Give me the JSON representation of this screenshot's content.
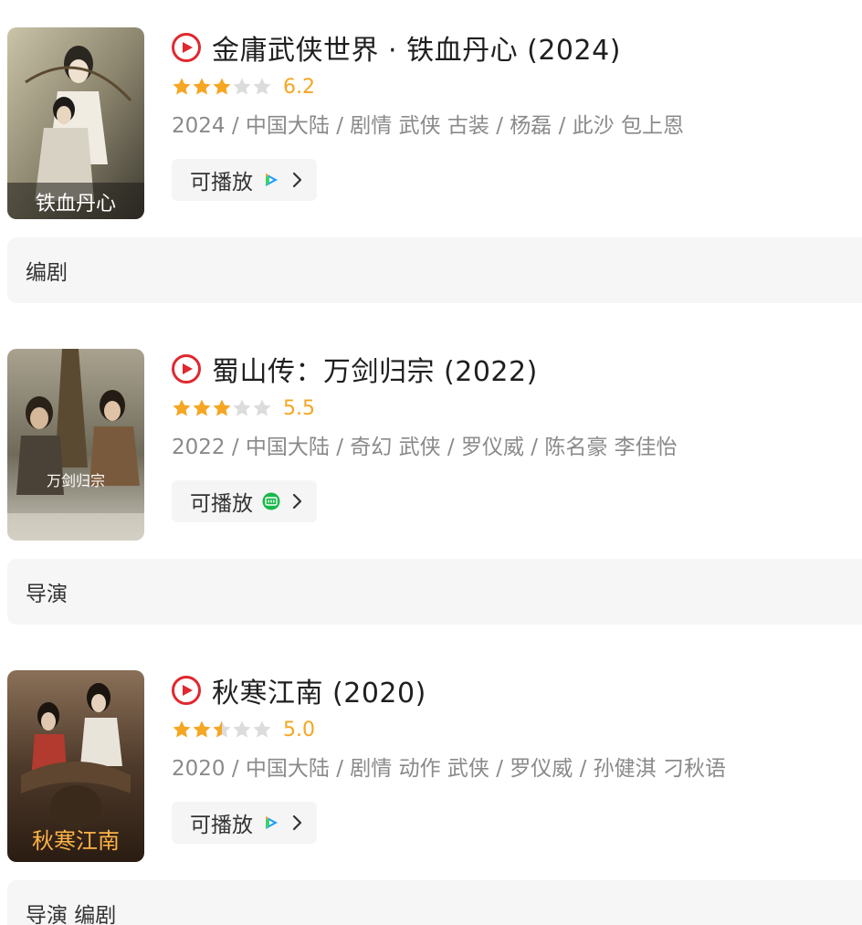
{
  "entries": [
    {
      "title": "金庸武侠世界 · 铁血丹心 (2024)",
      "stars_filled": 3,
      "stars_half": 0,
      "score": "6.2",
      "meta": "2024 / 中国大陆 / 剧情 武侠 古装 / 杨磊 / 此沙 包上恩",
      "play_label": "可播放",
      "platform_icon": "tencent-video-icon",
      "role": "编剧",
      "poster_text": "铁血丹心"
    },
    {
      "title": "蜀山传：万剑归宗 (2022)",
      "stars_filled": 3,
      "stars_half": 0,
      "score": "5.5",
      "meta": "2022 / 中国大陆 / 奇幻 武侠 / 罗仪威 / 陈名豪 李佳怡",
      "play_label": "可播放",
      "platform_icon": "iqiyi-icon",
      "role": "导演",
      "poster_text": "万剑归宗"
    },
    {
      "title": "秋寒江南 (2020)",
      "stars_filled": 2,
      "stars_half": 1,
      "score": "5.0",
      "meta": "2020 / 中国大陆 / 剧情 动作 武侠 / 罗仪威 / 孙健淇 刁秋语",
      "play_label": "可播放",
      "platform_icon": "tencent-video-icon",
      "role": "导演 编剧",
      "poster_text": "秋寒江南"
    }
  ],
  "colors": {
    "accent_red": "#e0282e",
    "star_gold": "#f5a623",
    "star_empty": "#dcdcdc",
    "iqiyi_green": "#18b84a",
    "tencent_blue": "#1e9dff",
    "tencent_green": "#3fd16a",
    "tencent_orange": "#ffa41c"
  }
}
